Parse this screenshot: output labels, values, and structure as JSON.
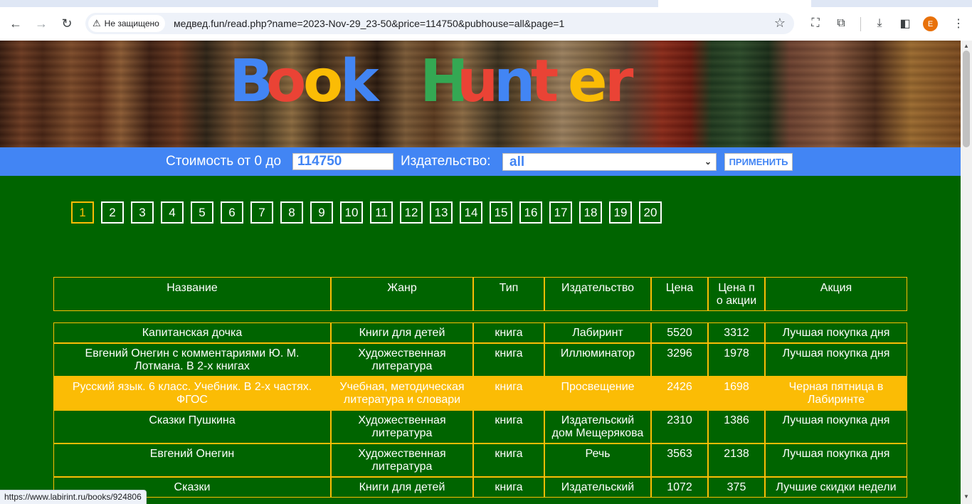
{
  "browser": {
    "security_label": "Не защищено",
    "url": "медвед.fun/read.php?name=2023-Nov-29_23-50&price=114750&pubhouse=all&page=1",
    "profile_initial": "E",
    "status_url": "https://www.labirint.ru/books/924806"
  },
  "banner": {
    "letters": [
      {
        "ch": "B",
        "color": "#4285f4"
      },
      {
        "ch": "o",
        "color": "#ea4335"
      },
      {
        "ch": "o",
        "color": "#fbbc05"
      },
      {
        "ch": "k",
        "color": "#4285f4"
      },
      {
        "ch": " ",
        "color": "#ffffff"
      },
      {
        "ch": "H",
        "color": "#34a853"
      },
      {
        "ch": "u",
        "color": "#ea4335"
      },
      {
        "ch": "n",
        "color": "#4285f4"
      },
      {
        "ch": "t",
        "color": "#ea4335"
      },
      {
        "ch": "e",
        "color": "#fbbc05"
      },
      {
        "ch": "r",
        "color": "#ea4335"
      }
    ]
  },
  "filter": {
    "price_label": "Стоимость от 0 до",
    "price_value": "114750",
    "publisher_label": "Издательство:",
    "publisher_value": "all",
    "apply_label": "ПРИМЕНИТЬ"
  },
  "pager": {
    "current": "1",
    "pages": [
      "1",
      "2",
      "3",
      "4",
      "5",
      "6",
      "7",
      "8",
      "9",
      "10",
      "11",
      "12",
      "13",
      "14",
      "15",
      "16",
      "17",
      "18",
      "19",
      "20"
    ]
  },
  "table": {
    "headers": [
      "Название",
      "Жанр",
      "Тип",
      "Издательство",
      "Цена",
      "Цена п о акции",
      "Акция"
    ],
    "rows": [
      {
        "title": "Капитанская дочка",
        "genre": "Книги для детей",
        "type": "книга",
        "publisher": "Лабиринт",
        "price": "5520",
        "sale_price": "3312",
        "promo": "Лучшая покупка дня",
        "highlight": false
      },
      {
        "title": "Евгений Онегин с комментариями Ю. М. Лотмана. В 2-х книгах",
        "genre": "Художественная литература",
        "type": "книга",
        "publisher": "Иллюминатор",
        "price": "3296",
        "sale_price": "1978",
        "promo": "Лучшая покупка дня",
        "highlight": false
      },
      {
        "title": "Русский язык. 6 класс. Учебник. В 2-х частях. ФГОС",
        "genre": "Учебная, методическая литература и словари",
        "type": "книга",
        "publisher": "Просвещение",
        "price": "2426",
        "sale_price": "1698",
        "promo": "Черная пятница в Лабиринте",
        "highlight": true
      },
      {
        "title": "Сказки Пушкина",
        "genre": "Художественная литература",
        "type": "книга",
        "publisher": "Издательский дом Мещерякова",
        "price": "2310",
        "sale_price": "1386",
        "promo": "Лучшая покупка дня",
        "highlight": false
      },
      {
        "title": "Евгений Онегин",
        "genre": "Художественная литература",
        "type": "книга",
        "publisher": "Речь",
        "price": "3563",
        "sale_price": "2138",
        "promo": "Лучшая покупка дня",
        "highlight": false
      },
      {
        "title": "Сказки",
        "genre": "Книги для детей",
        "type": "книга",
        "publisher": "Издательский",
        "price": "1072",
        "sale_price": "375",
        "promo": "Лучшие скидки недели",
        "highlight": false
      }
    ]
  }
}
